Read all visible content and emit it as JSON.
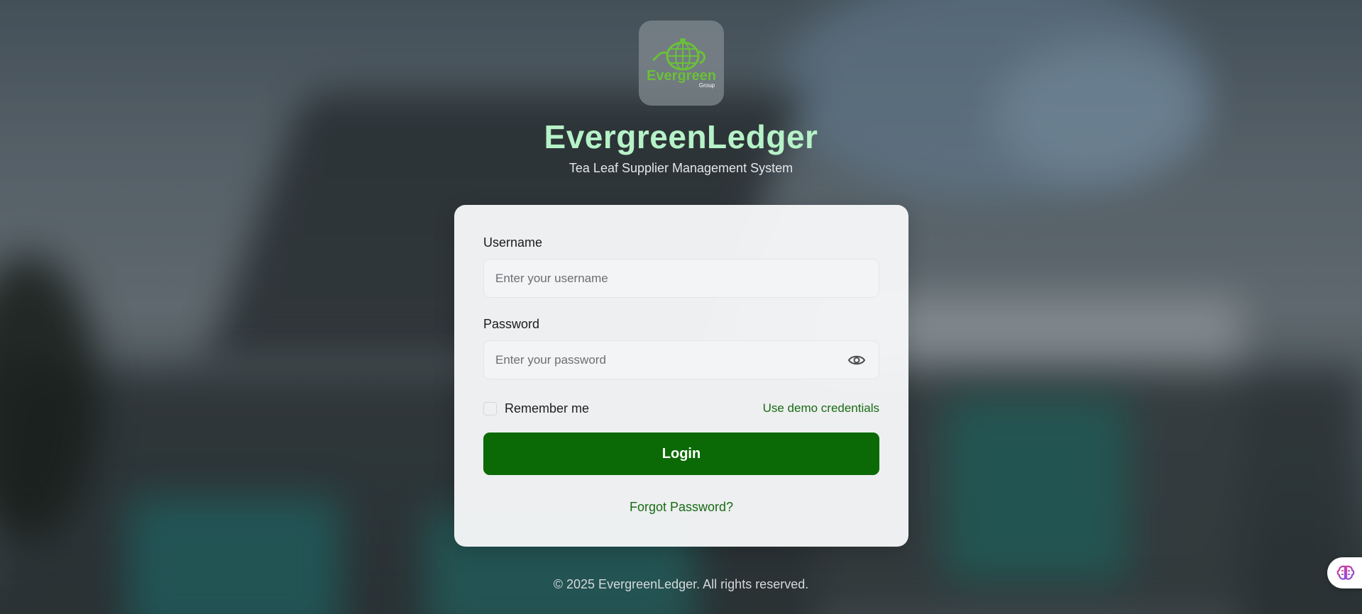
{
  "brand": {
    "logo_text": "Evergreen",
    "logo_subtext": "Group",
    "title": "EvergreenLedger",
    "subtitle": "Tea Leaf Supplier Management System"
  },
  "form": {
    "username_label": "Username",
    "username_placeholder": "Enter your username",
    "username_value": "",
    "password_label": "Password",
    "password_placeholder": "Enter your password",
    "password_value": "",
    "remember_label": "Remember me",
    "remember_checked": false,
    "demo_link": "Use demo credentials",
    "login_button": "Login",
    "forgot_link": "Forgot Password?"
  },
  "footer": {
    "copyright": "© 2025 EvergreenLedger. All rights reserved."
  },
  "icons": {
    "password_toggle": "eye-icon",
    "assistant": "brain-icon"
  },
  "colors": {
    "primary": "#0b6a06",
    "link": "#186b14",
    "title": "#b6f2c8",
    "logo_green": "#6bbf3a"
  }
}
